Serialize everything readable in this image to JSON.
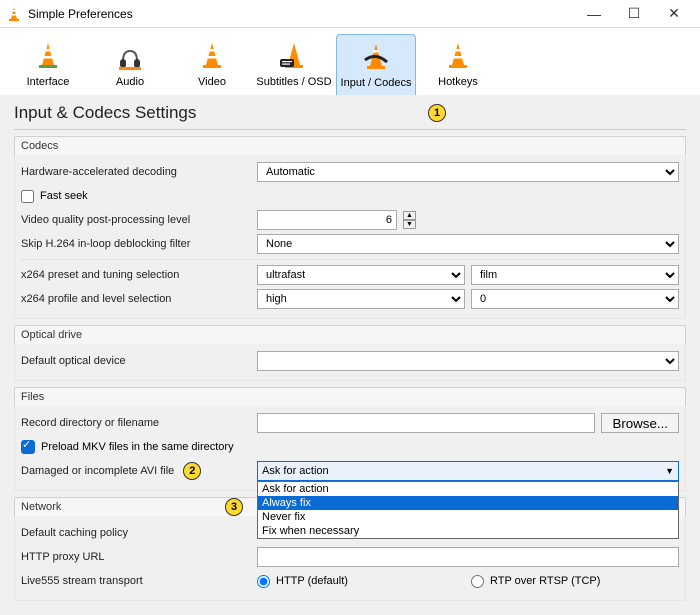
{
  "window": {
    "title": "Simple Preferences"
  },
  "tabs": {
    "interface": "Interface",
    "audio": "Audio",
    "video": "Video",
    "subtitles": "Subtitles / OSD",
    "input_codecs": "Input / Codecs",
    "hotkeys": "Hotkeys"
  },
  "page": {
    "title": "Input & Codecs Settings"
  },
  "markers": {
    "m1": "1",
    "m2": "2",
    "m3": "3"
  },
  "codecs": {
    "group": "Codecs",
    "hw_decode_label": "Hardware-accelerated decoding",
    "hw_decode_value": "Automatic",
    "fast_seek": "Fast seek",
    "vq_label": "Video quality post-processing level",
    "vq_value": "6",
    "skip_h264_label": "Skip H.264 in-loop deblocking filter",
    "skip_h264_value": "None",
    "x264_preset_label": "x264 preset and tuning selection",
    "x264_preset_v1": "ultrafast",
    "x264_preset_v2": "film",
    "x264_profile_label": "x264 profile and level selection",
    "x264_profile_v1": "high",
    "x264_profile_v2": "0"
  },
  "optical": {
    "group": "Optical drive",
    "device_label": "Default optical device",
    "device_value": ""
  },
  "files": {
    "group": "Files",
    "record_label": "Record directory or filename",
    "record_value": "",
    "browse": "Browse...",
    "preload_mkv": "Preload MKV files in the same directory",
    "avi_label": "Damaged or incomplete AVI file",
    "avi_selected": "Ask for action",
    "avi_opts": {
      "o0": "Ask for action",
      "o1": "Always fix",
      "o2": "Never fix",
      "o3": "Fix when necessary"
    }
  },
  "network": {
    "group": "Network",
    "caching_label": "Default caching policy",
    "proxy_label": "HTTP proxy URL",
    "proxy_value": "",
    "live555_label": "Live555 stream transport",
    "http_radio": "HTTP (default)",
    "rtp_radio": "RTP over RTSP (TCP)"
  }
}
